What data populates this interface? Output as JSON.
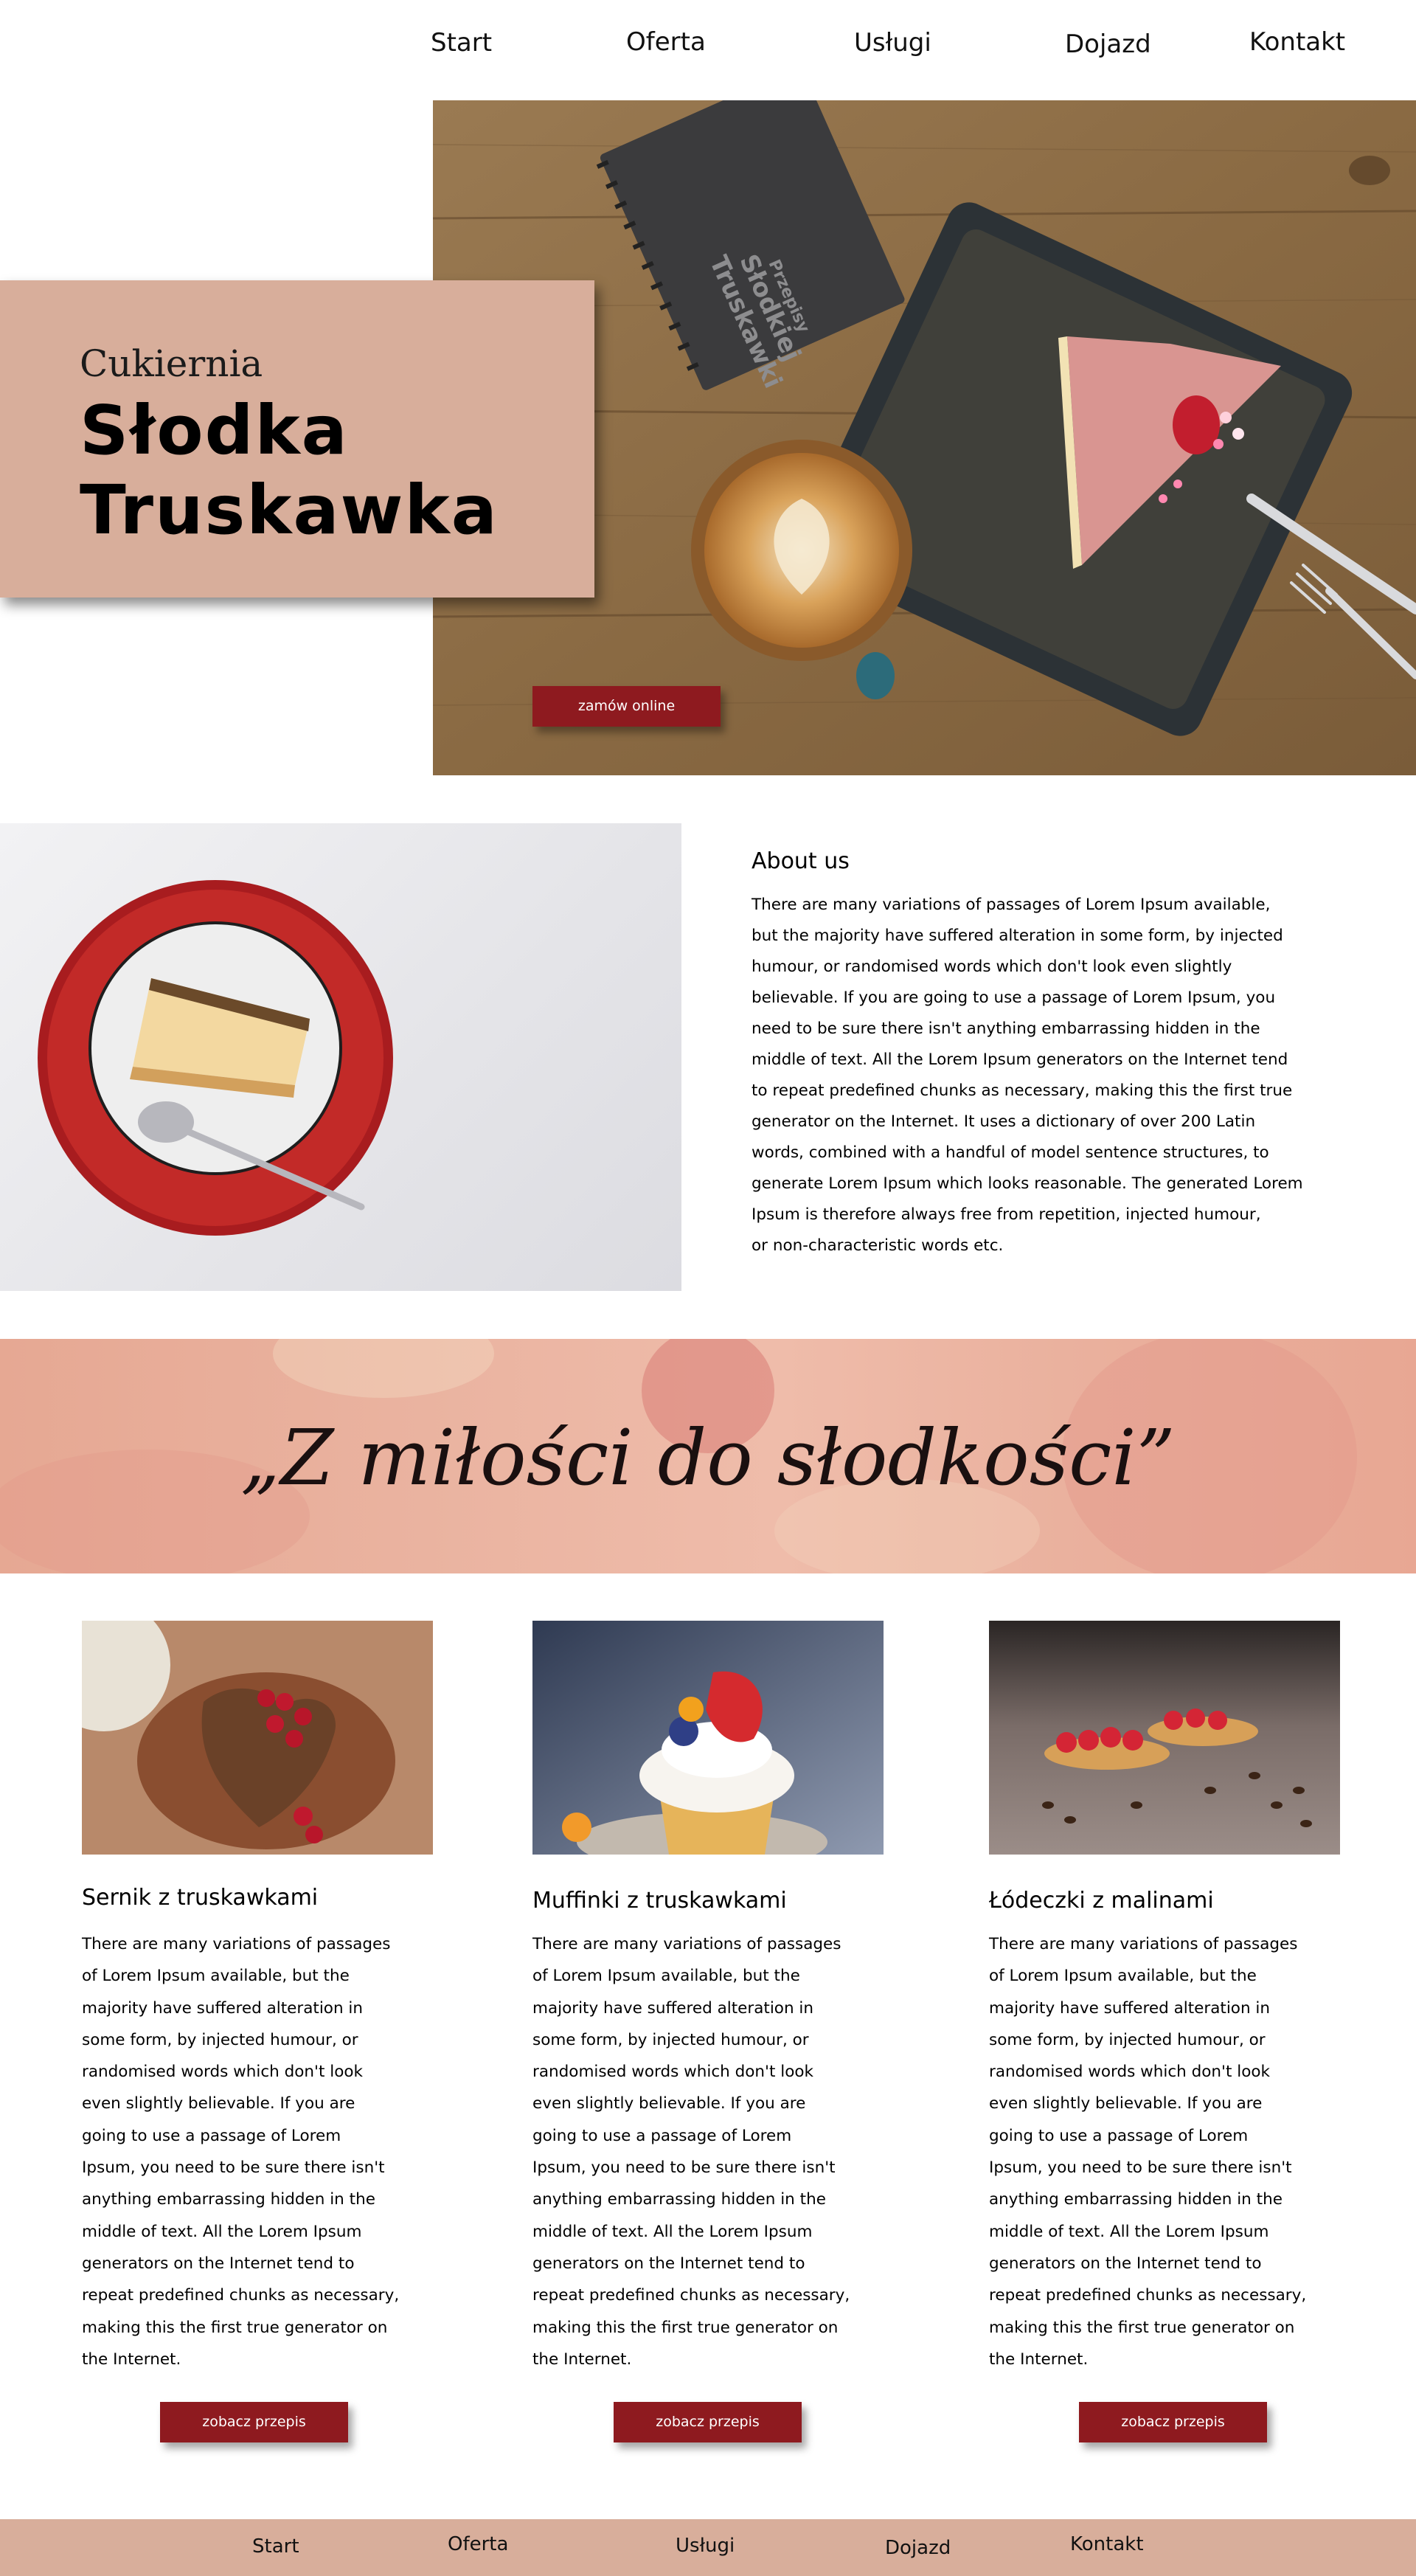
{
  "nav": {
    "items": [
      "Start",
      "Oferta",
      "Usługi",
      "Dojazd",
      "Kontakt"
    ]
  },
  "hero": {
    "subtitle": "Cukiernia",
    "title_line1": "Słodka",
    "title_line2": "Truskawka",
    "notebook_line1": "Przepisy",
    "notebook_line2": "Słodkiej",
    "notebook_line3": "Truskawki",
    "order_button": "zamów online"
  },
  "about": {
    "heading": "About us",
    "lines": [
      "There are many variations of passages of Lorem Ipsum available,",
      "but the majority have suffered alteration in some form, by injected",
      "humour, or randomised words which don't look even slightly",
      "believable. If you are going to use a passage of Lorem Ipsum, you",
      "need to be sure there isn't anything embarrassing hidden in the",
      "middle of text. All the Lorem Ipsum generators on the Internet tend",
      "to repeat predefined chunks as necessary, making this the first true",
      "generator on the Internet. It uses a dictionary of over 200 Latin",
      "words, combined with a handful of model sentence structures, to",
      "generate Lorem Ipsum which looks reasonable. The generated Lorem",
      "Ipsum is therefore always free from repetition, injected humour,",
      "or non-characteristic words etc."
    ]
  },
  "banner": {
    "quote": "„Z miłości do słodkości”"
  },
  "cards": [
    {
      "title": "Sernik z truskawkami",
      "lines": [
        "There are many variations of passages",
        "of Lorem Ipsum available, but the",
        "majority have suffered alteration in",
        "some form, by injected humour, or",
        "randomised words which don't look",
        "even slightly believable. If you are",
        "going to use a passage of Lorem",
        "Ipsum, you need to be sure there isn't",
        "anything embarrassing hidden in the",
        "middle of text. All the Lorem Ipsum",
        "generators on the Internet tend to",
        "repeat predefined chunks as necessary,",
        "making this the first true generator on",
        "the Internet."
      ],
      "button": "zobacz przepis"
    },
    {
      "title": "Muffinki z truskawkami",
      "lines": [
        "There are many variations of passages",
        "of Lorem Ipsum available, but the",
        "majority have suffered alteration in",
        "some form, by injected humour, or",
        "randomised words which don't look",
        "even slightly believable. If you are",
        "going to use a passage of Lorem",
        "Ipsum, you need to be sure there isn't",
        "anything embarrassing hidden in the",
        "middle of text. All the Lorem Ipsum",
        "generators on the Internet tend to",
        "repeat predefined chunks as necessary,",
        "making this the first true generator on",
        "the Internet."
      ],
      "button": "zobacz przepis"
    },
    {
      "title": "Łódeczki z malinami",
      "lines": [
        "There are many variations of passages",
        "of Lorem Ipsum available, but the",
        "majority have suffered alteration in",
        "some form, by injected humour, or",
        "randomised words which don't look",
        "even slightly believable. If you are",
        "going to use a passage of Lorem",
        "Ipsum, you need to be sure there isn't",
        "anything embarrassing hidden in the",
        "middle of text. All the Lorem Ipsum",
        "generators on the Internet tend to",
        "repeat predefined chunks as necessary,",
        "making this the first true generator on",
        "the Internet."
      ],
      "button": "zobacz przepis"
    }
  ],
  "footer": {
    "items": [
      "Start",
      "Oferta",
      "Usługi",
      "Dojazd",
      "Kontakt"
    ]
  },
  "colors": {
    "accent_red": "#8e1a1f",
    "blush": "#d8ae9b",
    "banner_pink": "#eab3a0"
  }
}
